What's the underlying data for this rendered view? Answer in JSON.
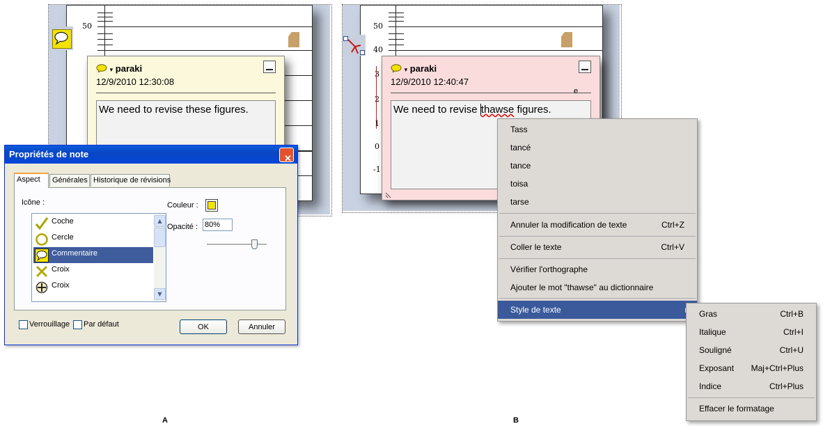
{
  "panels": {
    "a_label": "A",
    "b_label": "B"
  },
  "chart": {
    "tick_50": "50",
    "tick_40": "40",
    "tick_3": "3",
    "tick_2": "2",
    "tick_1": "1",
    "tick_0": "0",
    "tick_neg": "-1"
  },
  "noteA": {
    "author": "paraki",
    "date": "12/9/2010 12:30:08",
    "text": "We need to revise these figures.",
    "color": "#fbf8dc"
  },
  "noteB": {
    "author": "paraki",
    "date": "12/9/2010 12:40:47",
    "text_before": "We need to revise ",
    "text_misspelled": "thawse",
    "text_after": " figures.",
    "stray_char": "e",
    "color": "#fbdcdc"
  },
  "dialog": {
    "title": "Propriétés de note",
    "close_glyph": "✕",
    "tabs": [
      "Aspect",
      "Générales",
      "Historique de révisions"
    ],
    "icon_label": "Icône :",
    "icons": [
      {
        "label": "Coche",
        "icon": "check-icon"
      },
      {
        "label": "Cercle",
        "icon": "circle-icon"
      },
      {
        "label": "Commentaire",
        "icon": "comment-icon",
        "selected": true
      },
      {
        "label": "Croix",
        "icon": "cross-icon"
      },
      {
        "label": "Croix",
        "icon": "crosshair-icon"
      }
    ],
    "color_label": "Couleur :",
    "color_value": "#f2e205",
    "opacity_label": "Opacité :",
    "opacity_value": "80%",
    "lock_label": "Verrouillage",
    "default_label": "Par défaut",
    "ok_label": "OK",
    "cancel_label": "Annuler"
  },
  "context_menu": {
    "suggestions": [
      "Tass",
      "tancé",
      "tance",
      "toisa",
      "tarse"
    ],
    "undo": {
      "label": "Annuler la modification de texte",
      "shortcut": "Ctrl+Z"
    },
    "paste": {
      "label": "Coller le texte",
      "shortcut": "Ctrl+V"
    },
    "spellcheck": "Vérifier l'orthographe",
    "add_word": "Ajouter le mot \"thawse\" au dictionnaire",
    "text_style": "Style de texte",
    "submenu_arrow": "▶"
  },
  "submenu": {
    "items": [
      {
        "label": "Gras",
        "shortcut": "Ctrl+B"
      },
      {
        "label": "Italique",
        "shortcut": "Ctrl+I"
      },
      {
        "label": "Souligné",
        "shortcut": "Ctrl+U"
      },
      {
        "label": "Exposant",
        "shortcut": "Maj+Ctrl+Plus"
      },
      {
        "label": "Indice",
        "shortcut": "Ctrl+Plus"
      }
    ],
    "clear": "Effacer le formatage"
  }
}
